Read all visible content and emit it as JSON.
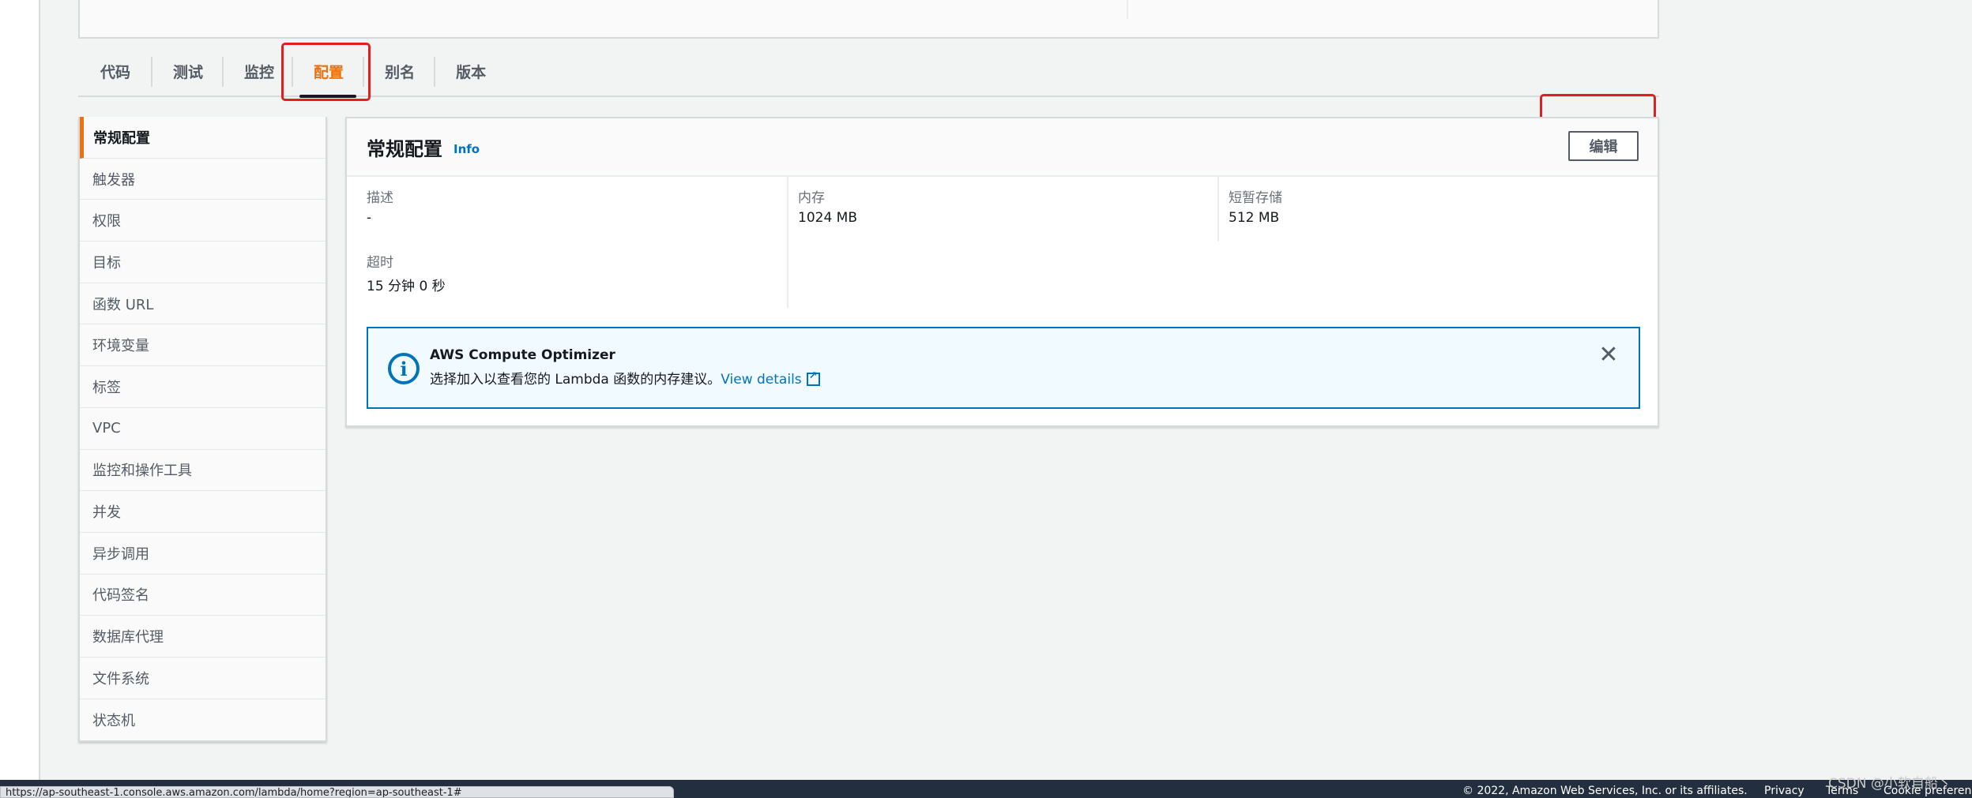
{
  "tabs": [
    {
      "label": "代码"
    },
    {
      "label": "测试"
    },
    {
      "label": "监控"
    },
    {
      "label": "配置"
    },
    {
      "label": "别名"
    },
    {
      "label": "版本"
    }
  ],
  "active_tab": "配置",
  "sidebar": {
    "items": [
      {
        "label": "常规配置"
      },
      {
        "label": "触发器"
      },
      {
        "label": "权限"
      },
      {
        "label": "目标"
      },
      {
        "label": "函数 URL"
      },
      {
        "label": "环境变量"
      },
      {
        "label": "标签"
      },
      {
        "label": "VPC"
      },
      {
        "label": "监控和操作工具"
      },
      {
        "label": "并发"
      },
      {
        "label": "异步调用"
      },
      {
        "label": "代码签名"
      },
      {
        "label": "数据库代理"
      },
      {
        "label": "文件系统"
      },
      {
        "label": "状态机"
      }
    ]
  },
  "panel": {
    "title": "常规配置",
    "info_link": "Info",
    "edit_button": "编辑",
    "fields": {
      "description": {
        "label": "描述",
        "value": "-"
      },
      "memory": {
        "label": "内存",
        "value": "1024 MB"
      },
      "ephemeral_storage": {
        "label": "短暂存储",
        "value": "512 MB"
      },
      "timeout": {
        "label": "超时",
        "value": "15 分钟  0 秒"
      }
    }
  },
  "alert": {
    "title": "AWS Compute Optimizer",
    "body": "选择加入以查看您的 Lambda 函数的内存建议。",
    "link": "View details",
    "close_symbol": "✕"
  },
  "footer": {
    "status_url": "https://ap-southeast-1.console.aws.amazon.com/lambda/home?region=ap-southeast-1#",
    "copyright": "© 2022, Amazon Web Services, Inc. or its affiliates.",
    "privacy": "Privacy",
    "terms": "Terms",
    "cookie": "Cookie preferen"
  },
  "watermark": "CSDN @小软自船丶",
  "colors": {
    "accent_orange": "#ec7211",
    "link_blue": "#0073bb",
    "highlight_red": "#e02020",
    "footer_bg": "#232f3e"
  }
}
